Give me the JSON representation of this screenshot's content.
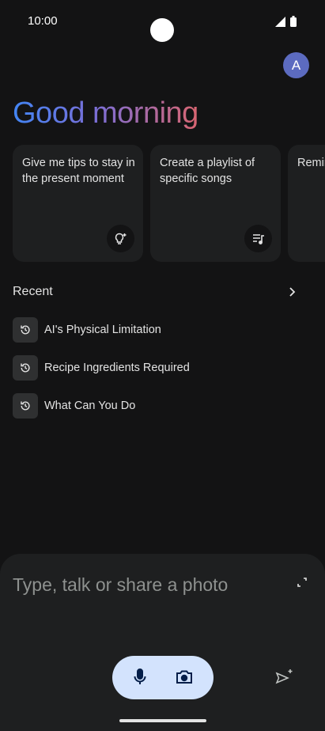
{
  "status_bar": {
    "time": "10:00"
  },
  "user": {
    "avatar_initial": "A"
  },
  "greeting": "Good morning",
  "suggestions": [
    {
      "text": "Give me tips to stay in the present moment",
      "icon": "lightbulb-sparkle-icon"
    },
    {
      "text": "Create a playlist of specific songs",
      "icon": "playlist-icon"
    },
    {
      "text": "Remind me of errands",
      "icon": ""
    }
  ],
  "recent": {
    "title": "Recent",
    "items": [
      {
        "label": "AI's Physical Limitation"
      },
      {
        "label": "Recipe Ingredients Required"
      },
      {
        "label": "What Can You Do"
      }
    ]
  },
  "composer": {
    "placeholder": "Type, talk or share a photo"
  },
  "colors": {
    "background": "#131314",
    "surface": "#1e1f20",
    "pill": "#d3e3fd",
    "avatar": "#5c6bc0"
  }
}
